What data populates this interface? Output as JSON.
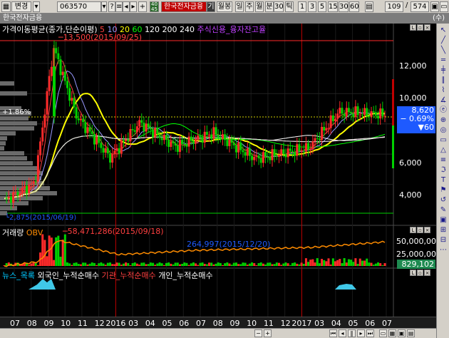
{
  "toolbar": {
    "left_label": "변경",
    "code": "063570",
    "buttons_small": [
      "?",
      "☰",
      "◀",
      "▶",
      "＋"
    ],
    "badge_top": "40",
    "badge_bottom": "45",
    "stock_name": "한국전자금융",
    "unit_label": "기",
    "period_label": "월봉",
    "period_day": "일",
    "period_week": "주",
    "period_month": "월",
    "minute_label": "분",
    "minute_value": "30",
    "tick_label": "틱",
    "periods": [
      "1",
      "3",
      "5",
      "15",
      "30",
      "60"
    ],
    "count": "109",
    "total": "574"
  },
  "window": {
    "title": "한국전자금융",
    "right_mark": "(수)"
  },
  "price_panel": {
    "ma_label": "가격이동평균(종가,단순이평)",
    "ma_periods": [
      "5",
      "10",
      "20",
      "60",
      "120",
      "200",
      "240"
    ],
    "ma_colors": [
      "#ff4040",
      "#9a9aff",
      "#ffff00",
      "#00ff00",
      "#ffffff",
      "#ffb6c1",
      "#ffffff"
    ],
    "extra_label": "주식신용_융자잔고율",
    "pct_label": "+1.86%",
    "high_label": "13,500(2015/09/25)",
    "low_label": "2,875(2015/06/19)",
    "y_ticks": [
      "12,000",
      "10,000",
      "8,000",
      "6,000",
      "4,000"
    ],
    "current_price": "8,620",
    "change_pct": "− 0.69%",
    "change_abs": "▼60"
  },
  "volume_panel": {
    "label": "거래량",
    "obv_label": "OBV",
    "obv_high": "58,471,286(2015/09/18)",
    "mid_label": "264,997(2015/12/20)",
    "y_ticks": [
      "50,000,00",
      "25,000,00"
    ],
    "current": "829,102"
  },
  "flow_panel": {
    "labels": [
      "뉴스_목록",
      "외국인_누적순매수",
      "기관_누적순매수",
      "개인_누적순매수"
    ]
  },
  "x_ticks": [
    "07",
    "08",
    "09",
    "10",
    "11",
    "12",
    "2016",
    "03",
    "04",
    "05",
    "06",
    "07",
    "08",
    "09",
    "10",
    "11",
    "12",
    "2017",
    "03",
    "04",
    "05",
    "06",
    "07"
  ],
  "colors": {
    "up": "#ff2a2a",
    "down": "#00d000",
    "bg": "#000000",
    "accent": "#1e5aff"
  }
}
